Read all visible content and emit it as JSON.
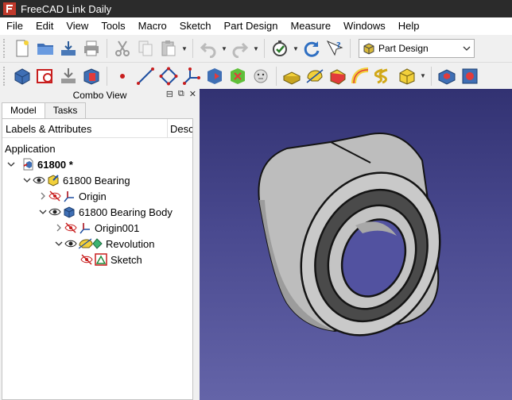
{
  "window": {
    "title": "FreeCAD Link Daily"
  },
  "menubar": {
    "items": [
      "File",
      "Edit",
      "View",
      "Tools",
      "Macro",
      "Sketch",
      "Part Design",
      "Measure",
      "Windows",
      "Help"
    ]
  },
  "toolbar": {
    "workbench": "Part Design"
  },
  "combo_view": {
    "title": "Combo View",
    "tabs": [
      {
        "label": "Model",
        "active": true
      },
      {
        "label": "Tasks",
        "active": false
      }
    ],
    "tree": {
      "columns": [
        "Labels & Attributes",
        "Description"
      ],
      "section": "Application",
      "rows": [
        {
          "label": "61800 *",
          "bold": true,
          "icon": "document-icon",
          "expanded": true
        },
        {
          "label": "61800 Bearing",
          "icon": "part-icon",
          "expanded": true,
          "visible": true
        },
        {
          "label": "Origin",
          "icon": "origin-icon",
          "expanded": false,
          "visible": false
        },
        {
          "label": "61800 Bearing Body",
          "icon": "body-icon",
          "expanded": true,
          "visible": true
        },
        {
          "label": "Origin001",
          "icon": "origin-icon",
          "expanded": false,
          "visible": false
        },
        {
          "label": "Revolution",
          "icon": "revolution-icon",
          "expanded": true,
          "visible": true
        },
        {
          "label": "Sketch",
          "icon": "sketch-icon",
          "visible": false
        }
      ]
    }
  },
  "colors": {
    "titlebar": "#2b2b2b",
    "viewport_top": "#323272",
    "viewport_bottom": "#6464a8",
    "model_face": "#bdbdbd",
    "seal": "#4a4a4a"
  }
}
